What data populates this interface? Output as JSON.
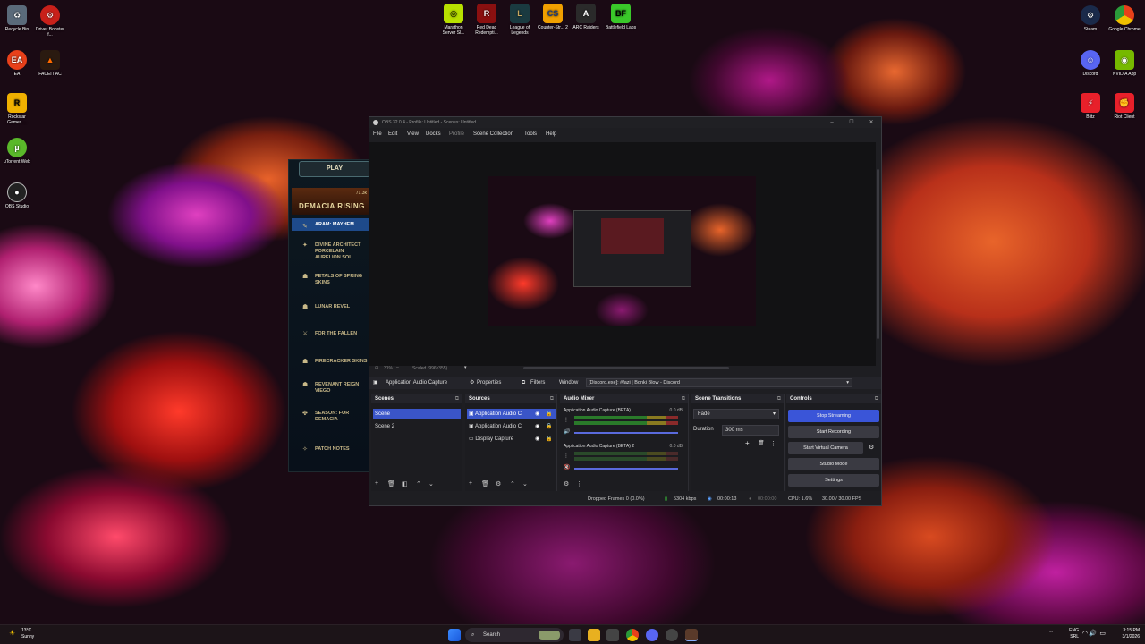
{
  "desktop_icons": {
    "recycle_bin": "Recycle Bin",
    "driver_booster": "Driver Booster f...",
    "ea": "EA",
    "faceit": "FACEIT AC",
    "rockstar": "Rockstar Games ...",
    "utorrent": "uTorrent Web",
    "obs_studio": "OBS Studio",
    "marathon": "Marathon Server Sl...",
    "rdr2": "Red Dead Redempti...",
    "lol": "League of Legends",
    "cs2": "Counter-Str... 2",
    "arc": "ARC Raiders",
    "bf": "Battlefield Labs",
    "steam": "Steam",
    "chrome": "Google Chrome",
    "discord": "Discord",
    "nvidia": "NVIDIA App",
    "blitz": "Blitz",
    "riot": "Riot Client"
  },
  "league": {
    "play": "PLAY",
    "banner": "DEMACIA RISING",
    "count": "71.3k",
    "items": [
      "ARAM: MAYHEM",
      "DIVINE ARCHITECT PORCELAIN AURELION SOL",
      "PETALS OF SPRING SKINS",
      "LUNAR REVEL",
      "FOR THE FALLEN",
      "FIRECRACKER SKINS",
      "REVENANT REIGN VIEGO",
      "SEASON: FOR DEMACIA",
      "PATCH NOTES"
    ]
  },
  "obs": {
    "title": "OBS 32.0.4 - Profile: Untitled - Scenes: Untitled",
    "menu": [
      "File",
      "Edit",
      "View",
      "Docks",
      "Profile",
      "Scene Collection",
      "Tools",
      "Help"
    ],
    "zoom": "31%",
    "scale": "Scaled (996x355)",
    "source_bar": {
      "source_name": "Application Audio Capture",
      "properties": "Properties",
      "filters": "Filters",
      "window_label": "Window",
      "window_value": "[Discord.exe]: #fazi | Bonki Blow - Discord"
    },
    "scenes": {
      "title": "Scenes",
      "items": [
        "Scene",
        "Scene 2"
      ]
    },
    "sources": {
      "title": "Sources",
      "items": [
        "Application Audio C",
        "Application Audio C",
        "Display Capture"
      ]
    },
    "mixer": {
      "title": "Audio Mixer",
      "channels": [
        {
          "name": "Application Audio Capture (BETA)",
          "db": "0.0 dB"
        },
        {
          "name": "Application Audio Capture (BETA) 2",
          "db": "0.0 dB"
        }
      ]
    },
    "transitions": {
      "title": "Scene Transitions",
      "type": "Fade",
      "duration_label": "Duration",
      "duration": "300 ms"
    },
    "controls": {
      "title": "Controls",
      "stop_streaming": "Stop Streaming",
      "start_recording": "Start Recording",
      "start_virtual_camera": "Start Virtual Camera",
      "studio_mode": "Studio Mode",
      "settings": "Settings"
    },
    "status": {
      "dropped": "Dropped Frames 0 (0.0%)",
      "kbps": "5304 kbps",
      "stream_time": "00:00:13",
      "rec_time": "00:00:00",
      "cpu": "CPU: 1.6%",
      "fps": "30.00 / 30.00 FPS"
    }
  },
  "taskbar": {
    "weather_temp": "13°C",
    "weather_desc": "Sunny",
    "search": "Search",
    "lang": "ENG",
    "region": "SRL",
    "time": "3:15 PM",
    "date": "3/1/2026"
  }
}
